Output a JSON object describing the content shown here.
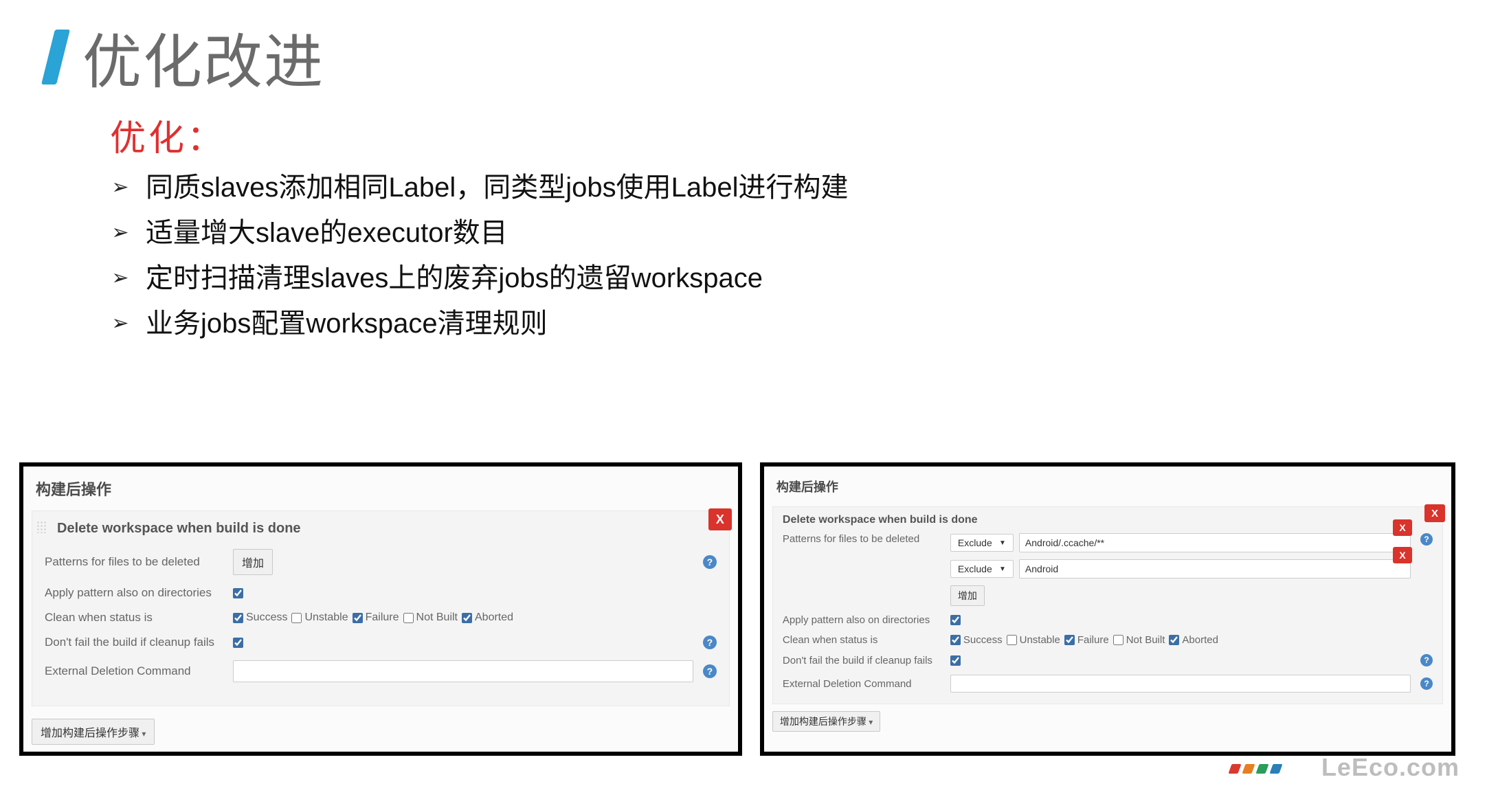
{
  "header": {
    "title": "优化改进"
  },
  "body": {
    "subtitle": "优化：",
    "bullets": [
      "同质slaves添加相同Label，同类型jobs使用Label进行构建",
      "适量增大slave的executor数目",
      "定时扫描清理slaves上的废弃jobs的遗留workspace",
      "业务jobs配置workspace清理规则"
    ]
  },
  "panel_common": {
    "section_title": "构建后操作",
    "block_title": "Delete workspace when build is done",
    "labels": {
      "patterns": "Patterns for files to be deleted",
      "apply_dirs": "Apply pattern also on directories",
      "clean_status": "Clean when status is",
      "dont_fail": "Don't fail the build if cleanup fails",
      "ext_cmd": "External Deletion Command"
    },
    "add_btn": "增加",
    "footer_btn": "增加构建后操作步骤",
    "close_x": "X",
    "help": "?",
    "statuses": [
      {
        "label": "Success",
        "checked": true
      },
      {
        "label": "Unstable",
        "checked": false
      },
      {
        "label": "Failure",
        "checked": true
      },
      {
        "label": "Not Built",
        "checked": false
      },
      {
        "label": "Aborted",
        "checked": true
      }
    ],
    "apply_dirs_checked": true,
    "dont_fail_checked": true
  },
  "panel_right": {
    "exclude_label": "Exclude",
    "patterns": [
      {
        "mode": "Exclude",
        "value": "Android/.ccache/**"
      },
      {
        "mode": "Exclude",
        "value": "Android"
      }
    ]
  },
  "footer": {
    "logo_text": "LeEco.com",
    "dot_colors": [
      "#d93a2f",
      "#e67e22",
      "#2a9d5a",
      "#2a7fb8"
    ]
  }
}
